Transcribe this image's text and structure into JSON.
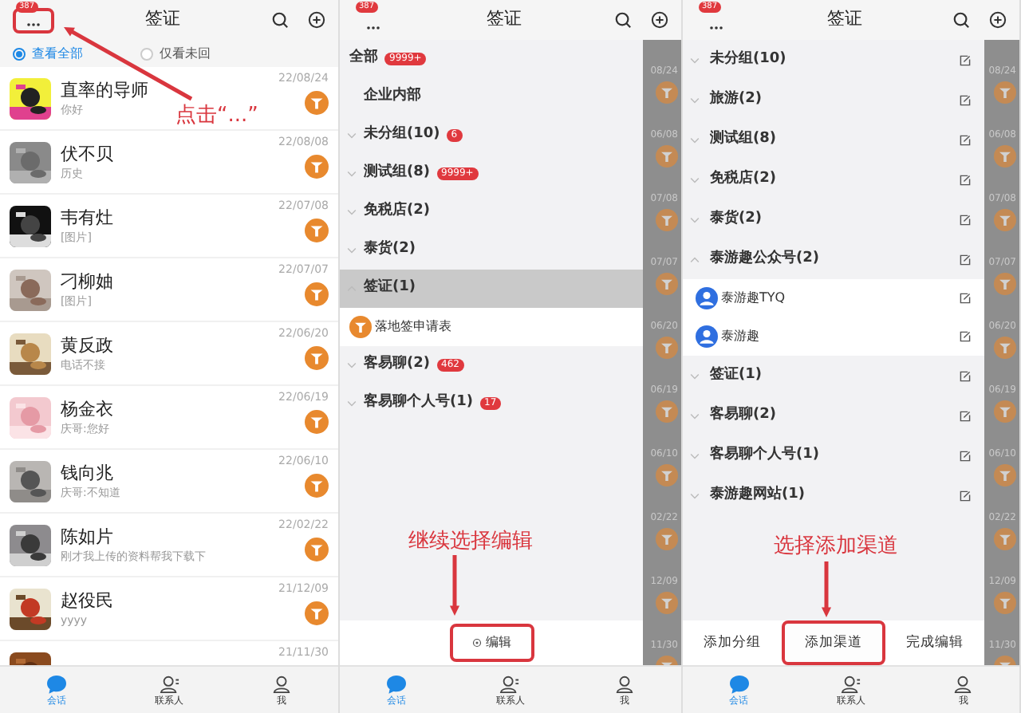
{
  "panels": [
    {
      "kind": "chat_list",
      "header": {
        "badge": "387",
        "title": "签证",
        "menu_highlighted": true
      },
      "filters": [
        {
          "label": "查看全部",
          "selected": true
        },
        {
          "label": "仅看未回",
          "selected": false
        }
      ],
      "chats": [
        {
          "name": "直率的导师",
          "preview": "你好",
          "date": "22/08/24"
        },
        {
          "name": "伏不贝",
          "preview": "历史",
          "date": "22/08/08"
        },
        {
          "name": "韦有灶",
          "preview": "[图片]",
          "date": "22/07/08"
        },
        {
          "name": "刁柳妯",
          "preview": "[图片]",
          "date": "22/07/07"
        },
        {
          "name": "黄反政",
          "preview": "电话不接",
          "date": "22/06/20"
        },
        {
          "name": "杨金衣",
          "preview": "庆哥:您好",
          "date": "22/06/19"
        },
        {
          "name": "钱向兆",
          "preview": "庆哥:不知道",
          "date": "22/06/10"
        },
        {
          "name": "陈如片",
          "preview": "刚才我上传的资料帮我下载下",
          "date": "22/02/22"
        },
        {
          "name": "赵役民",
          "preview": "yyyy",
          "date": "21/12/09"
        },
        {
          "date": "21/11/30"
        }
      ],
      "annotation": "点击“...”",
      "tabs": [
        {
          "label": "会话",
          "selected": true
        },
        {
          "label": "联系人",
          "selected": false
        },
        {
          "label": "我",
          "selected": false
        }
      ]
    },
    {
      "kind": "group_drawer",
      "header": {
        "badge": "387",
        "title": "签证",
        "menu_highlighted": false
      },
      "groups": [
        {
          "kind": "top",
          "label": "全部",
          "badge": "9999+",
          "selected": false
        },
        {
          "kind": "plain",
          "label": "企业内部",
          "selected": false
        },
        {
          "kind": "group",
          "label": "未分组(10)",
          "badge": "6",
          "selected": false,
          "expanded": false
        },
        {
          "kind": "group",
          "label": "测试组(8)",
          "badge": "9999+",
          "selected": false,
          "expanded": false
        },
        {
          "kind": "group",
          "label": "免税店(2)",
          "selected": false,
          "expanded": false
        },
        {
          "kind": "group",
          "label": "泰货(2)",
          "selected": false,
          "expanded": false
        },
        {
          "kind": "group",
          "label": "签证(1)",
          "selected": true,
          "expanded": true,
          "children": [
            {
              "label": "落地签申请表"
            }
          ]
        },
        {
          "kind": "group",
          "label": "客易聊(2)",
          "badge": "462",
          "selected": false,
          "expanded": false
        },
        {
          "kind": "group",
          "label": "客易聊个人号(1)",
          "badge": "17",
          "selected": false,
          "expanded": false
        }
      ],
      "strip_dates": [
        "08/24",
        "06/08",
        "07/08",
        "07/07",
        "06/20",
        "06/19",
        "06/10",
        "02/22",
        "12/09",
        "11/30"
      ],
      "edit_button": {
        "label": "编辑",
        "highlighted": true
      },
      "annotation": "继续选择编辑",
      "tabs": [
        {
          "label": "会话",
          "selected": true
        },
        {
          "label": "联系人",
          "selected": false
        },
        {
          "label": "我",
          "selected": false
        }
      ]
    },
    {
      "kind": "edit_drawer",
      "header": {
        "badge": "387",
        "title": "签证",
        "menu_highlighted": false
      },
      "groups": [
        {
          "label": "未分组(10)",
          "expanded": false
        },
        {
          "label": "旅游(2)",
          "expanded": false
        },
        {
          "label": "测试组(8)",
          "expanded": false
        },
        {
          "label": "免税店(2)",
          "expanded": false
        },
        {
          "label": "泰货(2)",
          "expanded": false
        },
        {
          "label": "泰游趣公众号(2)",
          "expanded": true,
          "children": [
            {
              "label": "泰游趣TYQ"
            },
            {
              "label": "泰游趣"
            }
          ]
        },
        {
          "label": "签证(1)",
          "expanded": false
        },
        {
          "label": "客易聊(2)",
          "expanded": false
        },
        {
          "label": "客易聊个人号(1)",
          "expanded": false
        },
        {
          "label": "泰游趣网站(1)",
          "expanded": false
        }
      ],
      "strip_dates": [
        "08/24",
        "06/08",
        "07/08",
        "07/07",
        "06/20",
        "06/19",
        "06/10",
        "02/22",
        "12/09",
        "11/30"
      ],
      "buttons": [
        {
          "label": "添加分组",
          "highlighted": false
        },
        {
          "label": "添加渠道",
          "highlighted": true
        },
        {
          "label": "完成编辑",
          "highlighted": false
        }
      ],
      "annotation": "选择添加渠道",
      "tabs": [
        {
          "label": "会话",
          "selected": true
        },
        {
          "label": "联系人",
          "selected": false
        },
        {
          "label": "我",
          "selected": false
        }
      ]
    }
  ]
}
